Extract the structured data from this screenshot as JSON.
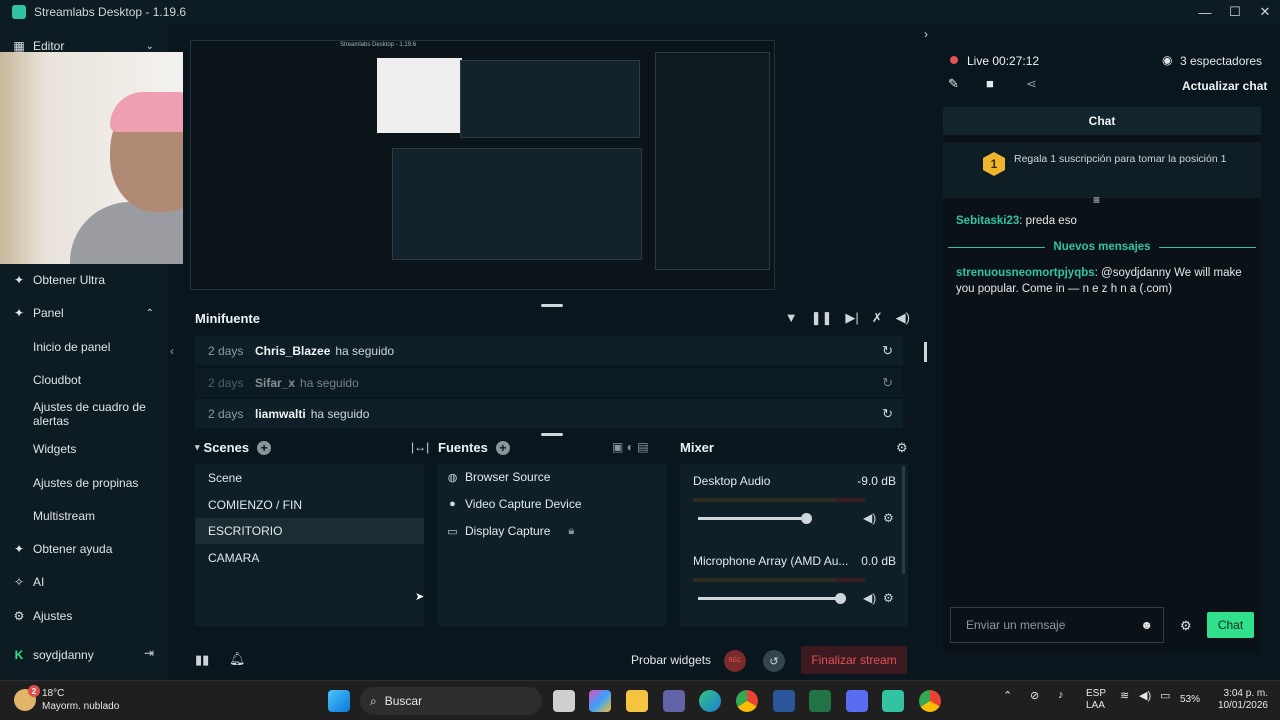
{
  "window": {
    "title": "Streamlabs Desktop - 1.19.6",
    "minimize": "—",
    "maximize": "☐",
    "close": "✕"
  },
  "sidebar": {
    "editor": "Editor",
    "obtener_ultra": "Obtener Ultra",
    "panel": "Panel",
    "panel_items": [
      "Inicio de panel",
      "Cloudbot",
      "Ajustes de cuadro de alertas",
      "Widgets",
      "Ajustes de propinas",
      "Multistream"
    ],
    "obtener_ayuda": "Obtener ayuda",
    "ai": "AI",
    "ajustes": "Ajustes",
    "user": "soydjdanny"
  },
  "preview": {
    "inner_title": "Streamlabs Desktop - 1.19.6"
  },
  "minifuente": {
    "title": "Minifuente",
    "events": [
      {
        "time": "2 days",
        "name": "Chris_Blazee",
        "action": "ha seguido"
      },
      {
        "time": "2 days",
        "name": "Sifar_x",
        "action": "ha seguido"
      },
      {
        "time": "2 days",
        "name": "liamwalti",
        "action": "ha seguido"
      }
    ]
  },
  "scenes": {
    "title": "Scenes",
    "items": [
      "Scene",
      "COMIENZO / FIN",
      "ESCRITORIO",
      "CAMARA"
    ],
    "active": "ESCRITORIO"
  },
  "fuentes": {
    "title": "Fuentes",
    "items": [
      "Browser Source",
      "Video Capture Device",
      "Display Capture"
    ]
  },
  "mixer": {
    "title": "Mixer",
    "channels": [
      {
        "name": "Desktop Audio",
        "db": "-9.0 dB",
        "level": 0.76
      },
      {
        "name": "Microphone Array (AMD Au...",
        "db": "0.0 dB",
        "level": 1.0
      }
    ]
  },
  "footer": {
    "probar": "Probar widgets",
    "rec": "REC",
    "finalizar": "Finalizar stream"
  },
  "live": {
    "label": "Live 00:27:12",
    "viewers": "3 espectadores",
    "actualizar": "Actualizar chat"
  },
  "chat": {
    "title": "Chat",
    "gift_rank": "1",
    "gift_text": "Regala 1 suscripción para tomar la posición 1",
    "messages": [
      {
        "user": "Sebitaski23",
        "text": ": preda eso"
      },
      {
        "user": "strenuousneomortpjyqbs",
        "text": ": @soydjdanny We will make you popular. Come in — n e z h n a (.com)"
      }
    ],
    "new_messages": "Nuevos mensajes",
    "placeholder": "Enviar un mensaje",
    "send": "Chat"
  },
  "taskbar": {
    "temp": "18°C",
    "weather": "Mayorm. nublado",
    "weather_badge": "2",
    "search": "Buscar",
    "lang1": "ESP",
    "lang2": "LAA",
    "battery": "53%",
    "time": "3:04 p. m.",
    "date": "10/01/2026"
  },
  "colors": {
    "accent": "#31c3a2",
    "live_red": "#e0535a",
    "chat_button": "#31e08a",
    "background": "#09161d"
  }
}
